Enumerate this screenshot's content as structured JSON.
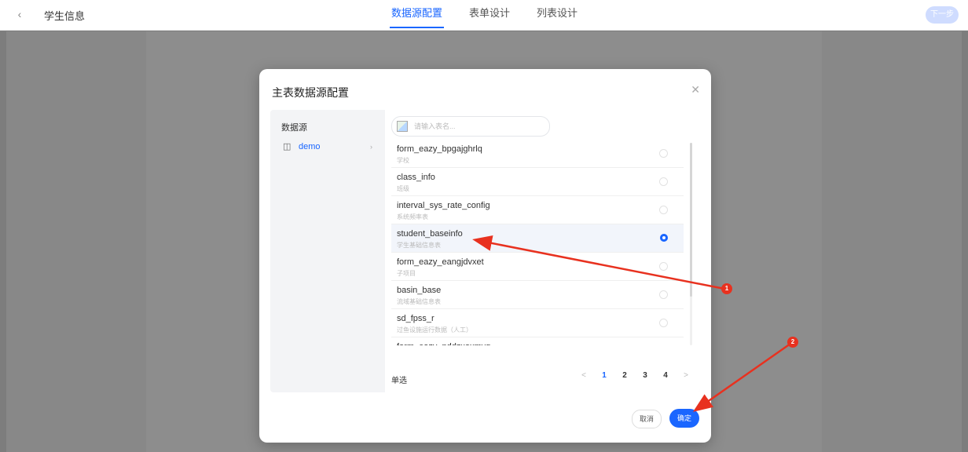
{
  "header": {
    "title": "学生信息",
    "tabs": [
      {
        "label": "数据源配置",
        "active": true
      },
      {
        "label": "表单设计",
        "active": false
      },
      {
        "label": "列表设计",
        "active": false
      }
    ],
    "next_label": "下一步"
  },
  "modal": {
    "title": "主表数据源配置",
    "datasource_heading": "数据源",
    "datasource_item": "demo",
    "search_placeholder": "请输入表名...",
    "rows": [
      {
        "name": "form_eazy_bpgajghrlq",
        "desc": "学校"
      },
      {
        "name": "class_info",
        "desc": "班级"
      },
      {
        "name": "interval_sys_rate_config",
        "desc": "系统频率表"
      },
      {
        "name": "student_baseinfo",
        "desc": "学生基础信息表",
        "selected": true
      },
      {
        "name": "form_eazy_eangjdvxet",
        "desc": "子项目"
      },
      {
        "name": "basin_base",
        "desc": "流域基础信息表"
      },
      {
        "name": "sd_fpss_r",
        "desc": "过鱼设施运行数据（人工）"
      },
      {
        "name": "form_eazy_pddzxoxmyq",
        "desc": ""
      }
    ],
    "select_mode": "单选",
    "pagination": {
      "prev": "<",
      "pages": [
        "1",
        "2",
        "3",
        "4"
      ],
      "current": "1",
      "next": ">"
    },
    "cancel_label": "取消",
    "ok_label": "确定"
  },
  "annotations": [
    {
      "label": "1",
      "color": "#e8311f"
    },
    {
      "label": "2",
      "color": "#e8311f"
    }
  ]
}
